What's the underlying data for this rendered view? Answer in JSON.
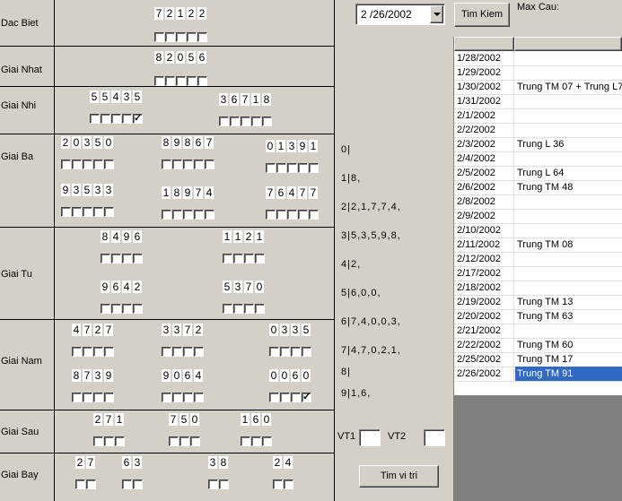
{
  "labels": {
    "dac_biet": "Dac Biet",
    "giai_nhat": "Giai Nhat",
    "giai_nhi": "Giai Nhi",
    "giai_ba": "Giai Ba",
    "giai_tu": "Giai Tu",
    "giai_nam": "Giai Nam",
    "giai_sau": "Giai Sau",
    "giai_bay": "Giai Bay"
  },
  "prizes": {
    "dac_biet": "72122",
    "giai_nhat": "82056",
    "giai_nhi": [
      "55435",
      "36718"
    ],
    "giai_ba": [
      "20350",
      "89867",
      "01391",
      "93533",
      "18974",
      "76477"
    ],
    "giai_tu": [
      "8496",
      "1121",
      "9642",
      "5370"
    ],
    "giai_nam": [
      "4727",
      "3372",
      "0335",
      "8739",
      "9064",
      "0060"
    ],
    "giai_sau": [
      "271",
      "750",
      "160"
    ],
    "giai_bay": [
      "27",
      "63",
      "38",
      "24"
    ]
  },
  "checked": {
    "giai_nhi_0_4": true,
    "giai_nam_5_3": true
  },
  "stats": [
    "0|",
    "1|8,",
    "2|2,1,7,7,4,",
    "3|5,3,5,9,8,",
    "4|2,",
    "5|6,0,0,",
    "6|7,4,0,0,3,",
    "7|4,7,0,2,1,",
    "8|",
    "9|1,6,"
  ],
  "vt1_label": "VT1",
  "vt2_label": "VT2",
  "vt1_value": "",
  "vt2_value": "",
  "date_picker": {
    "value": "2 /26/2002"
  },
  "buttons": {
    "search": "Tim Kiem",
    "find_position": "Tim vi tri"
  },
  "max_cau_label": "Max Cau:",
  "results_grid": {
    "headers": [
      "",
      ""
    ],
    "rows": [
      {
        "date": "1/28/2002",
        "value": ""
      },
      {
        "date": "1/29/2002",
        "value": ""
      },
      {
        "date": "1/30/2002",
        "value": "Trung TM 07 + Trung L7"
      },
      {
        "date": "1/31/2002",
        "value": ""
      },
      {
        "date": "2/1/2002",
        "value": ""
      },
      {
        "date": "2/2/2002",
        "value": ""
      },
      {
        "date": "2/3/2002",
        "value": "Trung L 36"
      },
      {
        "date": "2/4/2002",
        "value": ""
      },
      {
        "date": "2/5/2002",
        "value": "Trung L 64"
      },
      {
        "date": "2/6/2002",
        "value": "Trung TM 48"
      },
      {
        "date": "2/8/2002",
        "value": ""
      },
      {
        "date": "2/9/2002",
        "value": ""
      },
      {
        "date": "2/10/2002",
        "value": ""
      },
      {
        "date": "2/11/2002",
        "value": "Trung TM 08"
      },
      {
        "date": "2/12/2002",
        "value": ""
      },
      {
        "date": "2/17/2002",
        "value": ""
      },
      {
        "date": "2/18/2002",
        "value": ""
      },
      {
        "date": "2/19/2002",
        "value": "Trung TM 13"
      },
      {
        "date": "2/20/2002",
        "value": "Trung TM 63"
      },
      {
        "date": "2/21/2002",
        "value": ""
      },
      {
        "date": "2/22/2002",
        "value": "Trung TM 60"
      },
      {
        "date": "2/25/2002",
        "value": "Trung TM 17"
      },
      {
        "date": "2/26/2002",
        "value": "Trung TM 91"
      }
    ],
    "selected": "2/26/2002"
  }
}
